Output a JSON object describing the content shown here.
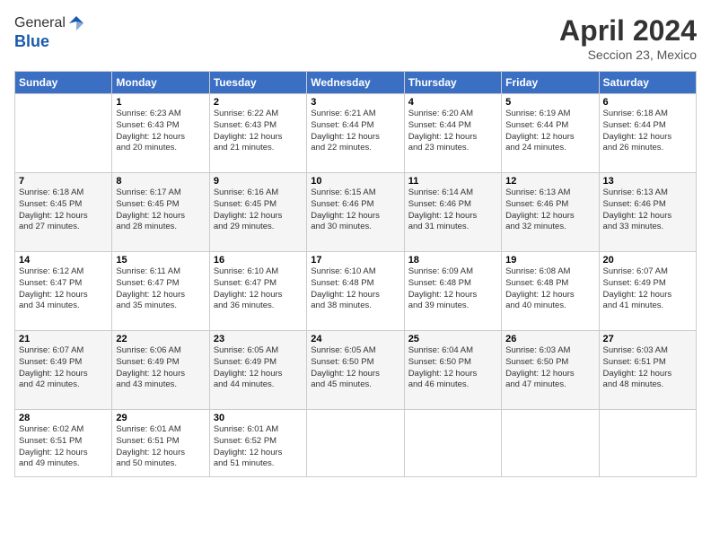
{
  "logo": {
    "general": "General",
    "blue": "Blue"
  },
  "title": "April 2024",
  "subtitle": "Seccion 23, Mexico",
  "calendar": {
    "headers": [
      "Sunday",
      "Monday",
      "Tuesday",
      "Wednesday",
      "Thursday",
      "Friday",
      "Saturday"
    ],
    "rows": [
      [
        {
          "day": "",
          "info": ""
        },
        {
          "day": "1",
          "info": "Sunrise: 6:23 AM\nSunset: 6:43 PM\nDaylight: 12 hours\nand 20 minutes."
        },
        {
          "day": "2",
          "info": "Sunrise: 6:22 AM\nSunset: 6:43 PM\nDaylight: 12 hours\nand 21 minutes."
        },
        {
          "day": "3",
          "info": "Sunrise: 6:21 AM\nSunset: 6:44 PM\nDaylight: 12 hours\nand 22 minutes."
        },
        {
          "day": "4",
          "info": "Sunrise: 6:20 AM\nSunset: 6:44 PM\nDaylight: 12 hours\nand 23 minutes."
        },
        {
          "day": "5",
          "info": "Sunrise: 6:19 AM\nSunset: 6:44 PM\nDaylight: 12 hours\nand 24 minutes."
        },
        {
          "day": "6",
          "info": "Sunrise: 6:18 AM\nSunset: 6:44 PM\nDaylight: 12 hours\nand 26 minutes."
        }
      ],
      [
        {
          "day": "7",
          "info": "Sunrise: 6:18 AM\nSunset: 6:45 PM\nDaylight: 12 hours\nand 27 minutes."
        },
        {
          "day": "8",
          "info": "Sunrise: 6:17 AM\nSunset: 6:45 PM\nDaylight: 12 hours\nand 28 minutes."
        },
        {
          "day": "9",
          "info": "Sunrise: 6:16 AM\nSunset: 6:45 PM\nDaylight: 12 hours\nand 29 minutes."
        },
        {
          "day": "10",
          "info": "Sunrise: 6:15 AM\nSunset: 6:46 PM\nDaylight: 12 hours\nand 30 minutes."
        },
        {
          "day": "11",
          "info": "Sunrise: 6:14 AM\nSunset: 6:46 PM\nDaylight: 12 hours\nand 31 minutes."
        },
        {
          "day": "12",
          "info": "Sunrise: 6:13 AM\nSunset: 6:46 PM\nDaylight: 12 hours\nand 32 minutes."
        },
        {
          "day": "13",
          "info": "Sunrise: 6:13 AM\nSunset: 6:46 PM\nDaylight: 12 hours\nand 33 minutes."
        }
      ],
      [
        {
          "day": "14",
          "info": "Sunrise: 6:12 AM\nSunset: 6:47 PM\nDaylight: 12 hours\nand 34 minutes."
        },
        {
          "day": "15",
          "info": "Sunrise: 6:11 AM\nSunset: 6:47 PM\nDaylight: 12 hours\nand 35 minutes."
        },
        {
          "day": "16",
          "info": "Sunrise: 6:10 AM\nSunset: 6:47 PM\nDaylight: 12 hours\nand 36 minutes."
        },
        {
          "day": "17",
          "info": "Sunrise: 6:10 AM\nSunset: 6:48 PM\nDaylight: 12 hours\nand 38 minutes."
        },
        {
          "day": "18",
          "info": "Sunrise: 6:09 AM\nSunset: 6:48 PM\nDaylight: 12 hours\nand 39 minutes."
        },
        {
          "day": "19",
          "info": "Sunrise: 6:08 AM\nSunset: 6:48 PM\nDaylight: 12 hours\nand 40 minutes."
        },
        {
          "day": "20",
          "info": "Sunrise: 6:07 AM\nSunset: 6:49 PM\nDaylight: 12 hours\nand 41 minutes."
        }
      ],
      [
        {
          "day": "21",
          "info": "Sunrise: 6:07 AM\nSunset: 6:49 PM\nDaylight: 12 hours\nand 42 minutes."
        },
        {
          "day": "22",
          "info": "Sunrise: 6:06 AM\nSunset: 6:49 PM\nDaylight: 12 hours\nand 43 minutes."
        },
        {
          "day": "23",
          "info": "Sunrise: 6:05 AM\nSunset: 6:49 PM\nDaylight: 12 hours\nand 44 minutes."
        },
        {
          "day": "24",
          "info": "Sunrise: 6:05 AM\nSunset: 6:50 PM\nDaylight: 12 hours\nand 45 minutes."
        },
        {
          "day": "25",
          "info": "Sunrise: 6:04 AM\nSunset: 6:50 PM\nDaylight: 12 hours\nand 46 minutes."
        },
        {
          "day": "26",
          "info": "Sunrise: 6:03 AM\nSunset: 6:50 PM\nDaylight: 12 hours\nand 47 minutes."
        },
        {
          "day": "27",
          "info": "Sunrise: 6:03 AM\nSunset: 6:51 PM\nDaylight: 12 hours\nand 48 minutes."
        }
      ],
      [
        {
          "day": "28",
          "info": "Sunrise: 6:02 AM\nSunset: 6:51 PM\nDaylight: 12 hours\nand 49 minutes."
        },
        {
          "day": "29",
          "info": "Sunrise: 6:01 AM\nSunset: 6:51 PM\nDaylight: 12 hours\nand 50 minutes."
        },
        {
          "day": "30",
          "info": "Sunrise: 6:01 AM\nSunset: 6:52 PM\nDaylight: 12 hours\nand 51 minutes."
        },
        {
          "day": "",
          "info": ""
        },
        {
          "day": "",
          "info": ""
        },
        {
          "day": "",
          "info": ""
        },
        {
          "day": "",
          "info": ""
        }
      ]
    ]
  }
}
